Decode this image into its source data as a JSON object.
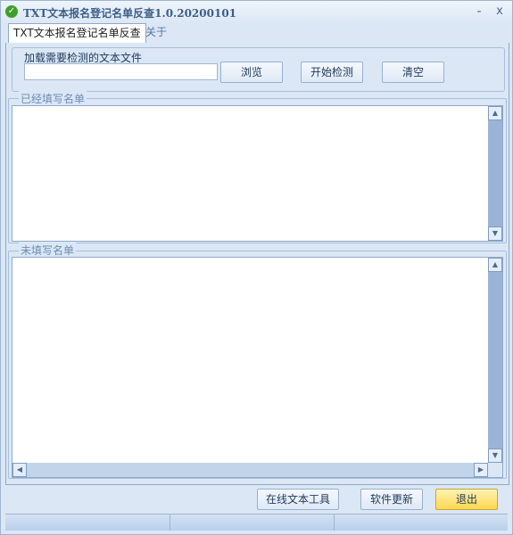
{
  "window": {
    "title": "TXT文本报名登记名单反查1.0.20200101",
    "minimize_glyph": "-",
    "close_glyph": "x"
  },
  "tabs": [
    {
      "label": "TXT文本报名登记名单反查",
      "active": true
    },
    {
      "label": "关于",
      "active": false
    }
  ],
  "load": {
    "label": "加载需要检测的文本文件",
    "file_value": "",
    "browse_label": "浏览",
    "start_label": "开始检测",
    "clear_label": "清空"
  },
  "filled_list": {
    "label": "已经填写名单",
    "items": []
  },
  "unfilled_list": {
    "label": "未填写名单",
    "items": []
  },
  "footer": {
    "online_tools_label": "在线文本工具",
    "update_label": "软件更新",
    "exit_label": "退出"
  },
  "colors": {
    "accent_exit": "#ffd84f",
    "window_bg": "#dbe7f5",
    "check_icon": "#3f9f2a"
  },
  "icons": {
    "app": "check-circle-icon",
    "scroll_up": "up-arrow-icon",
    "scroll_down": "down-arrow-icon",
    "scroll_left": "left-arrow-icon",
    "scroll_right": "right-arrow-icon"
  }
}
